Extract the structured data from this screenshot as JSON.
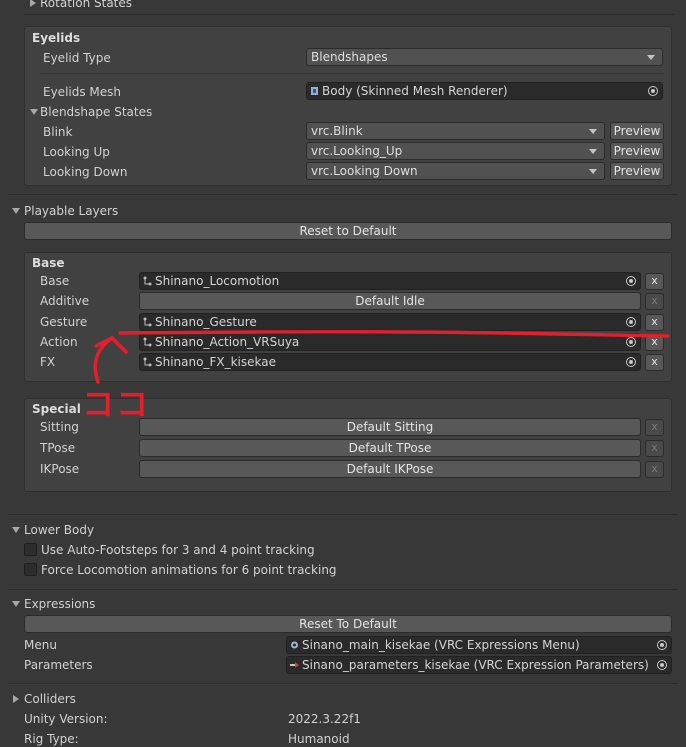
{
  "eyelids": {
    "collapsed_above": "Rotation States",
    "title": "Eyelids",
    "type_label": "Eyelid Type",
    "type_value": "Blendshapes",
    "mesh_label": "Eyelids Mesh",
    "mesh_value": "Body (Skinned Mesh Renderer)",
    "blendshape_states_label": "Blendshape States",
    "states": [
      {
        "label": "Blink",
        "value": "vrc.Blink",
        "button": "Preview"
      },
      {
        "label": "Looking Up",
        "value": "vrc.Looking_Up",
        "button": "Preview"
      },
      {
        "label": "Looking Down",
        "value": "vrc.Looking Down",
        "button": "Preview"
      }
    ]
  },
  "playable_layers": {
    "title": "Playable Layers",
    "reset_label": "Reset to Default",
    "base": {
      "title": "Base",
      "rows": [
        {
          "label": "Base",
          "value": "Shinano_Locomotion",
          "x": "x"
        },
        {
          "label": "Additive",
          "value": "Default Idle",
          "x": "x"
        },
        {
          "label": "Gesture",
          "value": "Shinano_Gesture",
          "x": "x"
        },
        {
          "label": "Action",
          "value": "Shinano_Action_VRSuya",
          "x": "x"
        },
        {
          "label": "FX",
          "value": "Shinano_FX_kisekae",
          "x": "x"
        }
      ]
    },
    "special": {
      "title": "Special",
      "rows": [
        {
          "label": "Sitting",
          "value": "Default Sitting",
          "x": "x"
        },
        {
          "label": "TPose",
          "value": "Default TPose",
          "x": "x"
        },
        {
          "label": "IKPose",
          "value": "Default IKPose",
          "x": "x"
        }
      ]
    }
  },
  "annotation": {
    "text": "ココ",
    "color": "#e0202c"
  },
  "lower_body": {
    "title": "Lower Body",
    "options": [
      {
        "label": "Use Auto-Footsteps for 3 and 4 point tracking"
      },
      {
        "label": "Force Locomotion animations for 6 point tracking"
      }
    ]
  },
  "expressions": {
    "title": "Expressions",
    "reset_label": "Reset To Default",
    "menu_label": "Menu",
    "menu_value": "Sinano_main_kisekae (VRC Expressions Menu)",
    "params_label": "Parameters",
    "params_value": "Sinano_parameters_kisekae (VRC Expression Parameters)"
  },
  "colliders": {
    "title": "Colliders"
  },
  "info": {
    "unity_version_label": "Unity Version:",
    "unity_version_value": "2022.3.22f1",
    "rig_type_label": "Rig Type:",
    "rig_type_value": "Humanoid"
  }
}
